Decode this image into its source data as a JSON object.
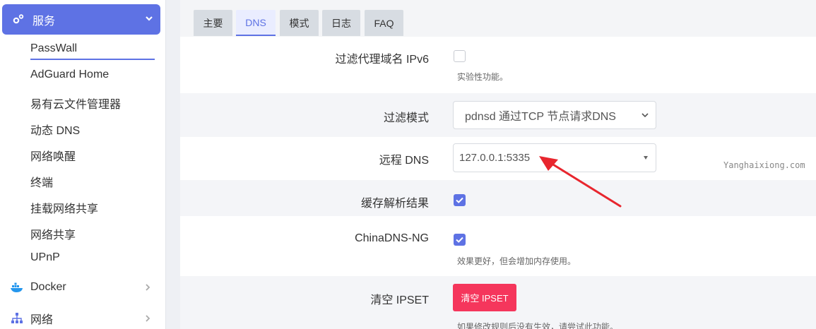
{
  "sidebar": {
    "active_group": {
      "label": "服务",
      "icon": "gears-icon",
      "expanded_icon": "chevron-down-icon"
    },
    "items": [
      {
        "label": "PassWall",
        "active": true
      },
      {
        "label": "AdGuard Home"
      },
      {
        "label": "易有云文件管理器"
      },
      {
        "label": "动态 DNS"
      },
      {
        "label": "网络唤醒"
      },
      {
        "label": "终端"
      },
      {
        "label": "挂载网络共享"
      },
      {
        "label": "网络共享"
      },
      {
        "label": "UPnP"
      }
    ],
    "groups": [
      {
        "label": "Docker",
        "icon": "docker-icon"
      },
      {
        "label": "网络",
        "icon": "network-icon"
      }
    ]
  },
  "tabs": [
    {
      "label": "主要"
    },
    {
      "label": "DNS",
      "active": true
    },
    {
      "label": "模式"
    },
    {
      "label": "日志"
    },
    {
      "label": "FAQ"
    }
  ],
  "form": {
    "filter_ipv6": {
      "label": "过滤代理域名 IPv6",
      "checked": false,
      "help": "实验性功能。"
    },
    "filter_mode": {
      "label": "过滤模式",
      "value": "pdnsd 通过TCP 节点请求DNS"
    },
    "remote_dns": {
      "label": "远程 DNS",
      "value": "127.0.0.1:5335"
    },
    "cache": {
      "label": "缓存解析结果",
      "checked": true
    },
    "chinadns": {
      "label": "ChinaDNS-NG",
      "checked": true,
      "help": "效果更好，但会增加内存使用。"
    },
    "clear_ipset": {
      "label": "清空 IPSET",
      "button": "清空 IPSET",
      "help": "如果修改规则后没有生效，请尝试此功能。"
    }
  },
  "watermark": "Yanghaixiong.com",
  "colors": {
    "accent": "#5e72e4",
    "danger": "#f5365c",
    "arrow": "#e8262e"
  }
}
